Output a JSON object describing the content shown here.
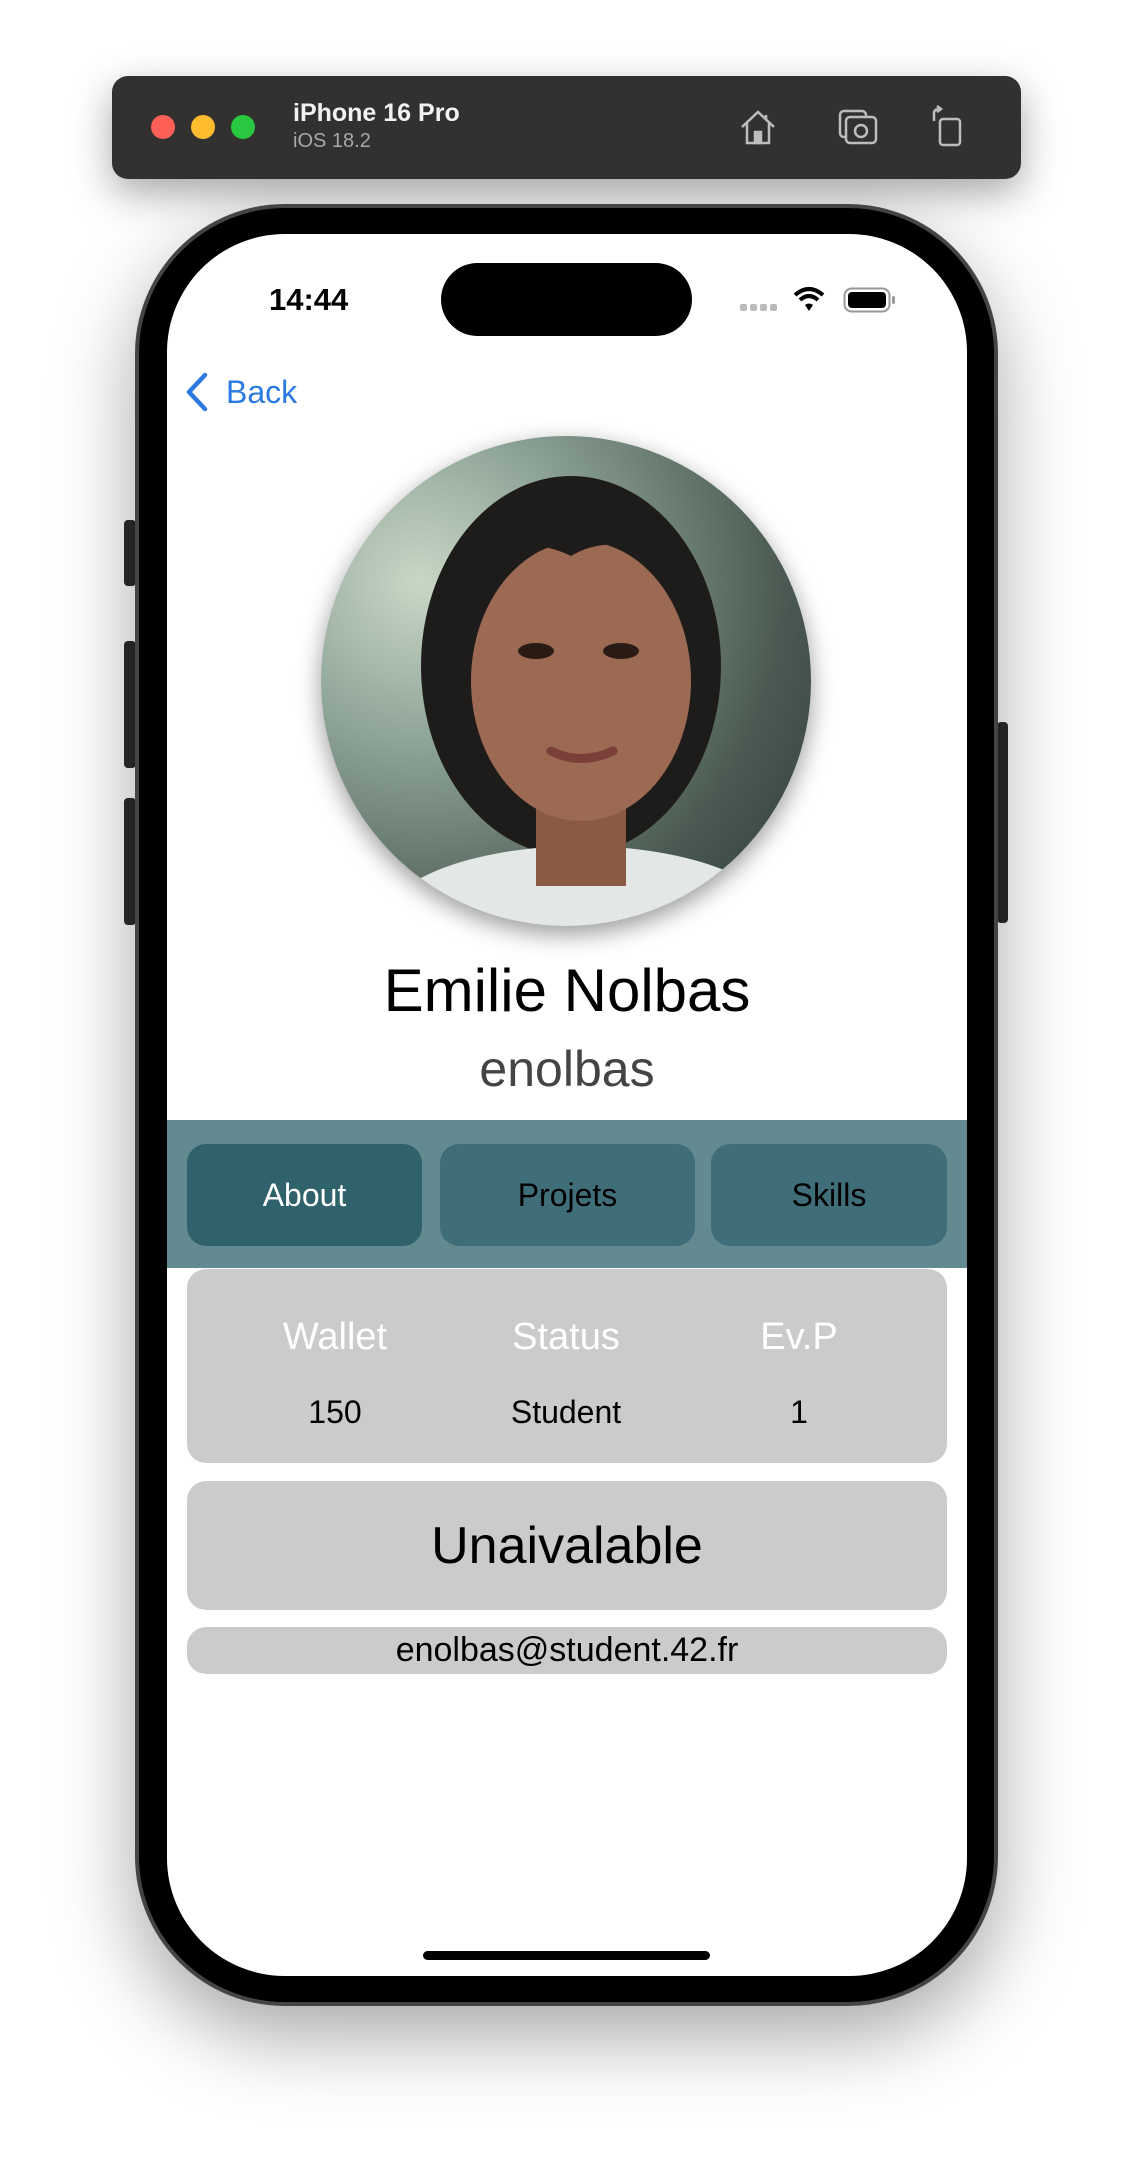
{
  "simulator": {
    "device_name": "iPhone 16 Pro",
    "os_version": "iOS 18.2",
    "icons": [
      "home-icon",
      "screenshot-icon",
      "rotate-icon"
    ]
  },
  "status_bar": {
    "time": "14:44"
  },
  "nav": {
    "back_label": "Back"
  },
  "profile": {
    "full_name": "Emilie Nolbas",
    "login": "enolbas"
  },
  "tabs": [
    {
      "label": "About",
      "active": true
    },
    {
      "label": "Projets",
      "active": false
    },
    {
      "label": "Skills",
      "active": false
    }
  ],
  "stats": {
    "headers": [
      "Wallet",
      "Status",
      "Ev.P"
    ],
    "values": [
      "150",
      "Student",
      "1"
    ]
  },
  "availability": "Unaivalable",
  "email": "enolbas@student.42.fr",
  "colors": {
    "accent_blue": "#2a7ae2",
    "tabbar_bg": "#628a90",
    "tab_active": "#2f626b",
    "tab_inactive": "#3f6e79",
    "card_bg": "#cbcbcd"
  }
}
